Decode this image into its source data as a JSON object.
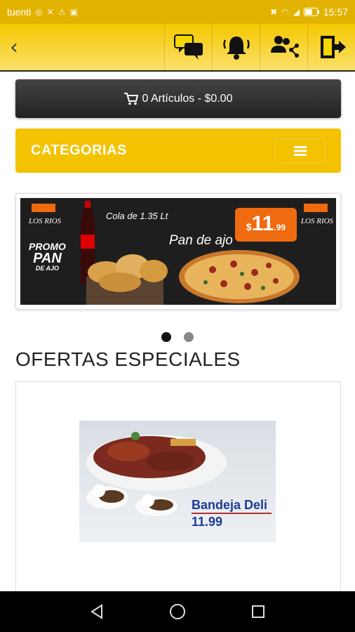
{
  "status_bar": {
    "carrier": "tuenti",
    "time": "15:57",
    "battery_fraction": 0.6
  },
  "header": {
    "icons": [
      "back-icon",
      "chat-icon",
      "bell-icon",
      "users-share-icon",
      "logout-icon"
    ]
  },
  "cart": {
    "label": "0 Artículos - $0.00"
  },
  "categories": {
    "title": "CATEGORIAS"
  },
  "banner": {
    "promo_line1": "PROMO",
    "promo_line2": "PAN",
    "promo_line3": "DE AJO",
    "cola_text": "Cola de 1.35 Lt",
    "pan_text": "Pan de ajo",
    "price_currency": "$",
    "price_main": "11",
    "price_cents": ".99",
    "logo_text": "LOS RIOS"
  },
  "carousel": {
    "total_slides": 2,
    "active_index": 0
  },
  "offers": {
    "title": "OFERTAS ESPECIALES",
    "items": [
      {
        "name": "Bandeja Deli",
        "price": "11.99"
      }
    ]
  },
  "colors": {
    "accent": "#f3c200",
    "status_bar": "#e1b300",
    "dark_button": "#333333",
    "price_tag": "#f06a10"
  }
}
